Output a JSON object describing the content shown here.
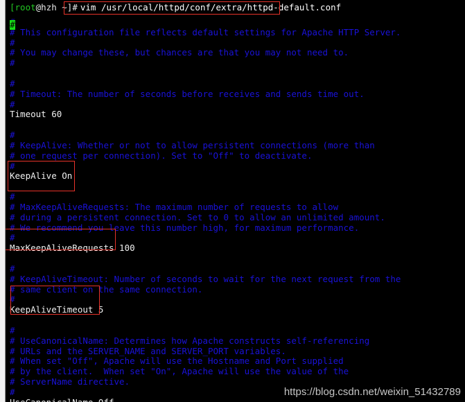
{
  "terminal": {
    "prompt": {
      "user_host": "[root@hzh ~]#",
      "user_part": "[root",
      "host_part": "@hzh ~]#",
      "command": "vim /usr/local/httpd/conf/extra/httpd-default.conf"
    },
    "cursor_char": "#",
    "colors": {
      "background": "#000000",
      "comment": "#1a12d8",
      "code": "#f0f0f0",
      "prompt_user": "#22c522",
      "prompt_text": "#e9e9e9",
      "annotation": "#e8332a",
      "cursor": "#16e016"
    }
  },
  "editor": {
    "filename": "httpd-default.conf",
    "lines": [
      {
        "text": "#",
        "type": "comment"
      },
      {
        "text": "# This configuration file reflects default settings for Apache HTTP Server.",
        "type": "comment"
      },
      {
        "text": "#",
        "type": "comment"
      },
      {
        "text": "# You may change these, but chances are that you may not need to.",
        "type": "comment"
      },
      {
        "text": "#",
        "type": "comment"
      },
      {
        "text": "",
        "type": "blank"
      },
      {
        "text": "#",
        "type": "comment"
      },
      {
        "text": "# Timeout: The number of seconds before receives and sends time out.",
        "type": "comment"
      },
      {
        "text": "#",
        "type": "comment"
      },
      {
        "text": "Timeout 60",
        "type": "code"
      },
      {
        "text": "",
        "type": "blank"
      },
      {
        "text": "#",
        "type": "comment"
      },
      {
        "text": "# KeepAlive: Whether or not to allow persistent connections (more than",
        "type": "comment"
      },
      {
        "text": "# one request per connection). Set to \"Off\" to deactivate.",
        "type": "comment"
      },
      {
        "text": "#",
        "type": "comment"
      },
      {
        "text": "KeepAlive On",
        "type": "code"
      },
      {
        "text": "",
        "type": "blank"
      },
      {
        "text": "#",
        "type": "comment"
      },
      {
        "text": "# MaxKeepAliveRequests: The maximum number of requests to allow",
        "type": "comment"
      },
      {
        "text": "# during a persistent connection. Set to 0 to allow an unlimited amount.",
        "type": "comment"
      },
      {
        "text": "# We recommend you leave this number high, for maximum performance.",
        "type": "comment"
      },
      {
        "text": "#",
        "type": "comment"
      },
      {
        "text": "MaxKeepAliveRequests 100",
        "type": "code"
      },
      {
        "text": "",
        "type": "blank"
      },
      {
        "text": "#",
        "type": "comment"
      },
      {
        "text": "# KeepAliveTimeout: Number of seconds to wait for the next request from the",
        "type": "comment"
      },
      {
        "text": "# same client on the same connection.",
        "type": "comment"
      },
      {
        "text": "#",
        "type": "comment"
      },
      {
        "text": "KeepAliveTimeout 5",
        "type": "code"
      },
      {
        "text": "",
        "type": "blank"
      },
      {
        "text": "#",
        "type": "comment"
      },
      {
        "text": "# UseCanonicalName: Determines how Apache constructs self-referencing",
        "type": "comment"
      },
      {
        "text": "# URLs and the SERVER_NAME and SERVER_PORT variables.",
        "type": "comment"
      },
      {
        "text": "# When set \"Off\", Apache will use the Hostname and Port supplied",
        "type": "comment"
      },
      {
        "text": "# by the client.  When set \"On\", Apache will use the value of the",
        "type": "comment"
      },
      {
        "text": "# ServerName directive.",
        "type": "comment"
      },
      {
        "text": "#",
        "type": "comment"
      },
      {
        "text": "UseCanonicalName Off",
        "type": "code"
      }
    ]
  },
  "annotations": [
    {
      "label": "command-highlight",
      "target": "vim /usr/local/httpd/conf/extra/httpd-default.conf"
    },
    {
      "label": "keepalive-highlight",
      "target": "KeepAlive On"
    },
    {
      "label": "maxkeepaliverequests-highlight",
      "target": "MaxKeepAliveRequests 100"
    },
    {
      "label": "keepalivetimeout-highlight",
      "target": "KeepAliveTimeout 5"
    }
  ],
  "watermark": {
    "text": "https://blog.csdn.net/weixin_51432789"
  }
}
